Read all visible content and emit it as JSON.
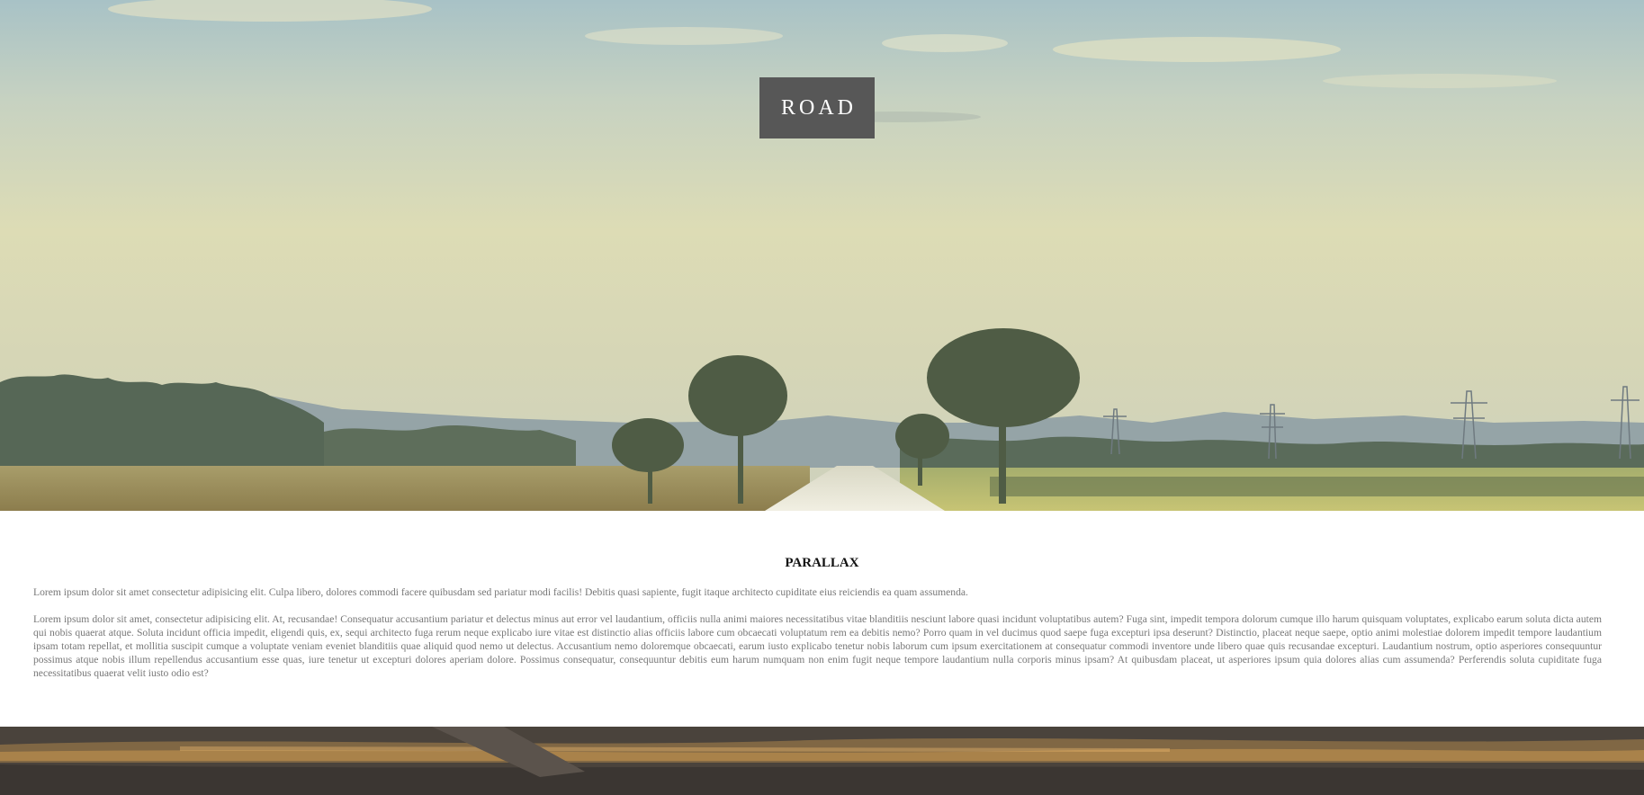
{
  "hero": {
    "title": "ROAD",
    "image": "road-landscape-image"
  },
  "section": {
    "title": "PARALLAX",
    "paragraphs": [
      "Lorem ipsum dolor sit amet consectetur adipisicing elit. Culpa libero, dolores commodi facere quibusdam sed pariatur modi facilis! Debitis quasi sapiente, fugit itaque architecto cupiditate eius reiciendis ea quam assumenda.",
      "Lorem ipsum dolor sit amet, consectetur adipisicing elit. At, recusandae! Consequatur accusantium pariatur et delectus minus aut error vel laudantium, officiis nulla animi maiores necessitatibus vitae blanditiis nesciunt labore quasi incidunt voluptatibus autem? Fuga sint, impedit tempora dolorum cumque illo harum quisquam voluptates, explicabo earum soluta dicta autem qui nobis quaerat atque. Soluta incidunt officia impedit, eligendi quis, ex, sequi architecto fuga rerum neque explicabo iure vitae est distinctio alias officiis labore cum obcaecati voluptatum rem ea debitis nemo? Porro quam in vel ducimus quod saepe fuga excepturi ipsa deserunt? Distinctio, placeat neque saepe, optio animi molestiae dolorem impedit tempore laudantium ipsam totam repellat, et mollitia suscipit cumque a voluptate veniam eveniet blanditiis quae aliquid quod nemo ut delectus. Accusantium nemo doloremque obcaecati, earum iusto explicabo tenetur nobis laborum cum ipsum exercitationem at consequatur commodi inventore unde libero quae quis recusandae excepturi. Laudantium nostrum, optio asperiores consequuntur possimus atque nobis illum repellendus accusantium esse quas, iure tenetur ut excepturi dolores aperiam dolore. Possimus consequatur, consequuntur debitis eum harum numquam non enim fugit neque tempore laudantium nulla corporis minus ipsam? At quibusdam placeat, ut asperiores ipsum quia dolores alias cum assumenda? Perferendis soluta cupiditate fuga necessitatibus quaerat velit iusto odio est?"
    ]
  },
  "bottom_band": {
    "image": "sunset-parallax-image"
  },
  "colors": {
    "title_box_bg": "#575757",
    "title_text": "#ffffff",
    "body_text": "#777777",
    "heading_text": "#111111"
  }
}
